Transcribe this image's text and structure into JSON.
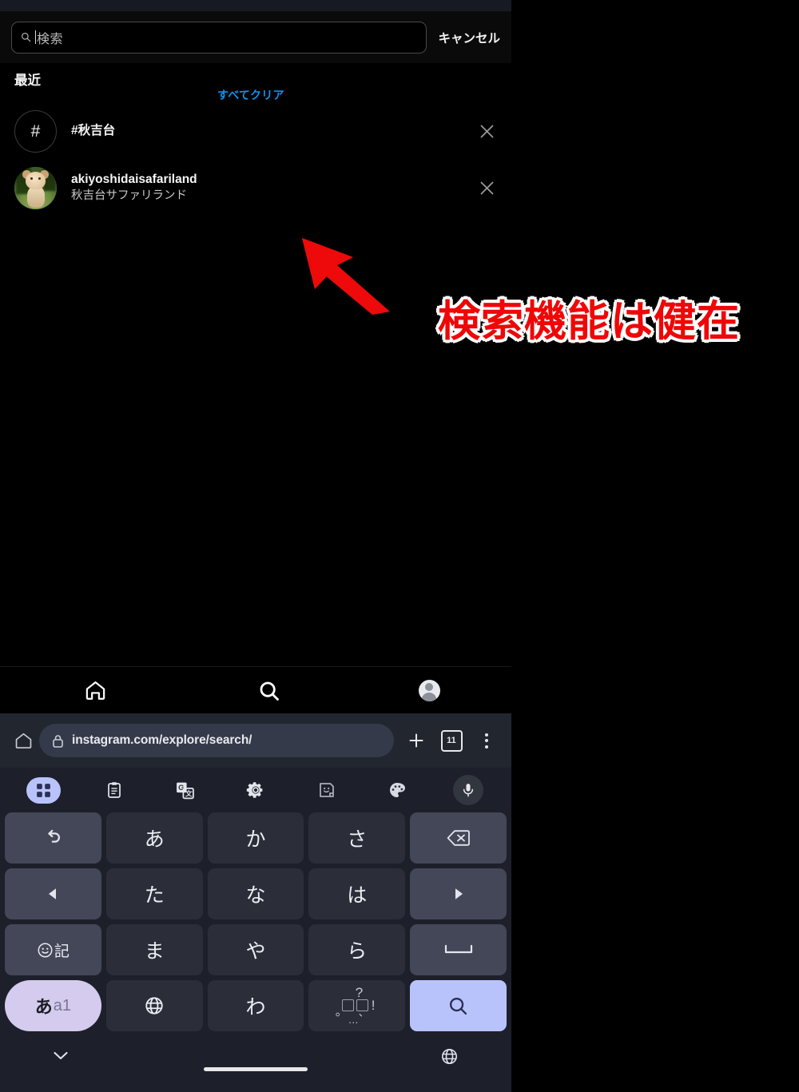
{
  "app": {
    "name": "Instagram",
    "screen": "explore-search"
  },
  "search_header": {
    "placeholder": "検索",
    "value": "",
    "cancel_label": "キャンセル",
    "search_icon": "search-icon"
  },
  "recent": {
    "title": "最近",
    "clear_all_label": "すべてクリア",
    "clear_all_color": "#0b93f0",
    "items": [
      {
        "type": "hashtag",
        "avatar_glyph": "#",
        "primary": "#秋吉台",
        "secondary": "",
        "remove_icon": "close-icon"
      },
      {
        "type": "account",
        "avatar_glyph": "",
        "primary": "akiyoshidaisafariland",
        "secondary": "秋吉台サファリランド",
        "remove_icon": "close-icon"
      }
    ]
  },
  "annotation": {
    "text": "検索機能は健在",
    "color": "#ef0707",
    "outline_color": "#ffffff",
    "arrow": "arrow-up-left"
  },
  "ig_nav": {
    "items": [
      {
        "icon": "home-icon",
        "label": "ホーム"
      },
      {
        "icon": "search-icon",
        "label": "検索"
      },
      {
        "icon": "profile-avatar-icon",
        "label": "プロフィール"
      }
    ]
  },
  "browser": {
    "home_icon": "home-icon",
    "lock_icon": "lock-icon",
    "url": "instagram.com/explore/search/",
    "new_tab_icon": "plus-icon",
    "tab_count": "11",
    "menu_icon": "more-vertical-icon"
  },
  "keyboard": {
    "toolbar": [
      {
        "icon": "grid-apps-icon",
        "active": true
      },
      {
        "icon": "clipboard-icon",
        "active": false
      },
      {
        "icon": "translate-icon",
        "active": false
      },
      {
        "icon": "gear-icon",
        "active": false
      },
      {
        "icon": "sticker-icon",
        "active": false
      },
      {
        "icon": "palette-icon",
        "active": false
      },
      {
        "icon": "microphone-icon",
        "active": false
      }
    ],
    "rows": [
      [
        {
          "label": "↺",
          "name": "undo-key",
          "style": "fn"
        },
        {
          "label": "あ",
          "name": "key-a",
          "style": "char"
        },
        {
          "label": "か",
          "name": "key-ka",
          "style": "char"
        },
        {
          "label": "さ",
          "name": "key-sa",
          "style": "char"
        },
        {
          "label": "⌫",
          "name": "backspace-key",
          "style": "fn"
        }
      ],
      [
        {
          "label": "◀",
          "name": "cursor-left-key",
          "style": "fn"
        },
        {
          "label": "た",
          "name": "key-ta",
          "style": "char"
        },
        {
          "label": "な",
          "name": "key-na",
          "style": "char"
        },
        {
          "label": "は",
          "name": "key-ha",
          "style": "char"
        },
        {
          "label": "▶",
          "name": "cursor-right-key",
          "style": "fn"
        }
      ],
      [
        {
          "label": "☺記",
          "name": "emoji-symbol-key",
          "style": "fn"
        },
        {
          "label": "ま",
          "name": "key-ma",
          "style": "char"
        },
        {
          "label": "や",
          "name": "key-ya",
          "style": "char"
        },
        {
          "label": "ら",
          "name": "key-ra",
          "style": "char"
        },
        {
          "label": "␣",
          "name": "space-key",
          "style": "fn"
        }
      ],
      [
        {
          "label": "あa1",
          "name": "ime-switch-key",
          "style": "ime"
        },
        {
          "label": "🌐",
          "name": "language-globe-key",
          "style": "char"
        },
        {
          "label": "わ",
          "name": "key-wa",
          "style": "char"
        },
        {
          "label": "、。?!",
          "name": "punctuation-key",
          "style": "char"
        },
        {
          "label": "🔍",
          "name": "search-enter-key",
          "style": "accent"
        }
      ]
    ],
    "ime_label_kana": "あ",
    "ime_label_alnum": "a1",
    "bottom": {
      "hide_keyboard_icon": "chevron-down-icon",
      "language_icon": "globe-icon",
      "home_indicator": "home-indicator"
    }
  },
  "colors": {
    "page_background": "#000000",
    "keyboard_background": "#1d202a",
    "key_char": "#2b2e38",
    "key_function": "#434757",
    "key_accent": "#b9c3fb",
    "browser_bar": "#22262f",
    "url_pill": "#353a4a",
    "link_blue": "#0b93f0",
    "annotation_red": "#ef0707"
  }
}
